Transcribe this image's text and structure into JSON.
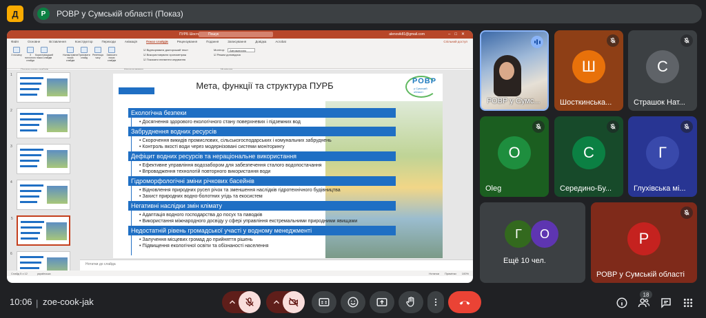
{
  "app": {
    "logo_glyph": "Д",
    "accent": "#f9ab00"
  },
  "meeting": {
    "avatar_letter": "Р",
    "title": "РОВР у Сумській області (Показ)"
  },
  "powerpoint": {
    "doc_name": "ПУРБ Шостинський р-н - PowerPoint",
    "search_placeholder": "Пошук",
    "user_email": "alenovik81@gmail.com",
    "tabs": [
      "Файл",
      "Основне",
      "Вставлення",
      "Конструктор",
      "Переходи",
      "Анімація",
      "Показ слайдів",
      "Рецензування",
      "Подання",
      "Записування",
      "Довідка",
      "Acrobat"
    ],
    "active_tab": "Показ слайдів",
    "share_label": "Спільний доступ",
    "ribbon_buttons": [
      "З початку",
      "З поточного слайда",
      "Користувацький показ слайдів",
      "Налаштувати показ слайдів",
      "Приховати слайд",
      "Репетиція часу",
      "Записати показ слайдів"
    ],
    "ribbon_checks": [
      "Відтворювати дикторський текст",
      "Використовувати хронометраж",
      "Показати елементи керування"
    ],
    "monitor_label": "Монітор:",
    "monitor_value": "Автоматично",
    "presenter_check": "Режим доповідача",
    "group_labels": [
      "Почати показ слайдів",
      "Налаштування",
      "Монітори"
    ],
    "notes_placeholder": "Нотатки до слайда",
    "status_left": "Слайд 5 з 12",
    "status_lang": "українська",
    "status_notes": "Нотатки",
    "status_comments": "Примітки",
    "zoom": "100%",
    "thumb_numbers": [
      "1",
      "2",
      "3",
      "4",
      "5",
      "6"
    ],
    "selected_thumb": "5"
  },
  "slide": {
    "title": "Мета, функції та структура ПУРБ",
    "logo_text": "РОВР",
    "logo_sub": "у Сумській області",
    "sections": [
      {
        "heading": "Екологічна безпеки",
        "bullets": [
          "Досягнення здорового екологічного стану поверхневих і підземних вод"
        ]
      },
      {
        "heading": "Забруднення водних ресурсів",
        "bullets": [
          "Скорочення викидів промислових, сільськогосподарських і комунальних забруднень",
          "Контроль якості води через модернізовані системи моніторингу"
        ]
      },
      {
        "heading": "Дефіцит водних ресурсів та нераціональне використання",
        "bullets": [
          "Ефективне управління водозабором для забезпечення сталого водопостачання",
          "Впровадження технологій повторного використання води"
        ]
      },
      {
        "heading": "Гідроморфологічні зміни річкових басейнів",
        "bullets": [
          "Відновлення природних русел річок та зменшення наслідків гідротехнічного будівництва",
          "Захист природних водно-болотних угідь та екосистем"
        ]
      },
      {
        "heading": "Негативні наслідки змін клімату",
        "bullets": [
          "Адаптація водного господарства до посух та паводків",
          "Використання міжнародного досвіду у сфері управління екстремальними природними явищами"
        ]
      },
      {
        "heading": "Недостатній рівень громадської участі у водному менеджменті",
        "bullets": [
          "Залучення місцевих громад до прийняття рішень",
          "Підвищення екологічної освіти та обізнаності населення"
        ]
      }
    ]
  },
  "participants": [
    {
      "name": "РОВР у Сумс...",
      "letter": "",
      "color": "#3c4043",
      "speaking": true
    },
    {
      "name": "Шосткинська...",
      "letter": "Ш",
      "color": "#e8710a",
      "bg": "#8e3f16",
      "muted": true
    },
    {
      "name": "Страшок Нат...",
      "letter": "С",
      "color": "#5f6368",
      "bg": "#3c4043",
      "muted": true
    },
    {
      "name": "Oleg",
      "letter": "O",
      "color": "#1e8e3e",
      "bg": "#1b5e20",
      "muted": true
    },
    {
      "name": "Середино-Бу...",
      "letter": "С",
      "color": "#0b8043",
      "bg": "#174a2a",
      "muted": true
    },
    {
      "name": "Глухівська мі...",
      "letter": "Г",
      "color": "#3949ab",
      "bg": "#283593",
      "muted": true
    },
    {
      "name": "Ещё 10 чел.",
      "letters": [
        "Г",
        "О"
      ],
      "colors": [
        "#33691e",
        "#5e35b1"
      ],
      "bg": "#3c4043"
    },
    {
      "name": "РОВР у Сумській області",
      "letter": "Р",
      "color": "#c5221f",
      "bg": "#7f2a1a",
      "muted": true
    }
  ],
  "bottom": {
    "time": "10:06",
    "separator": "|",
    "meeting_code": "zoe-cook-jak",
    "people_count": "18",
    "leave_color": "#ea4335"
  }
}
